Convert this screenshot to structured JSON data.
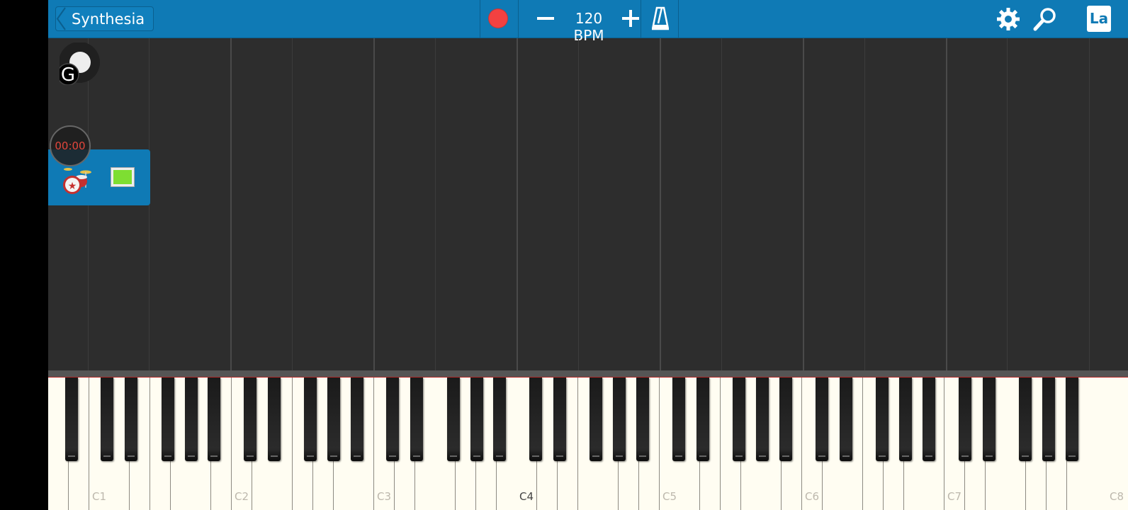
{
  "topbar": {
    "back_label": "Synthesia",
    "bpm_label": "120 BPM",
    "la_label": "La",
    "icons": [
      "back-chevron-icon",
      "record-icon",
      "minus-icon",
      "plus-icon",
      "metronome-icon",
      "gear-icon",
      "search-icon",
      "language-icon"
    ],
    "accent_color": "#0f7ab5",
    "record_color": "#f24141"
  },
  "toggle": {
    "label": "G"
  },
  "timer": {
    "time": "00:00"
  },
  "track": {
    "instrument_icon": "drum-kit-icon",
    "color": "#7ede32"
  },
  "keyboard": {
    "labels": {
      "C1": "C1",
      "C2": "C2",
      "C3": "C3",
      "C4": "C4",
      "C5": "C5",
      "C6": "C6",
      "C7": "C7",
      "C8": "C8"
    }
  }
}
